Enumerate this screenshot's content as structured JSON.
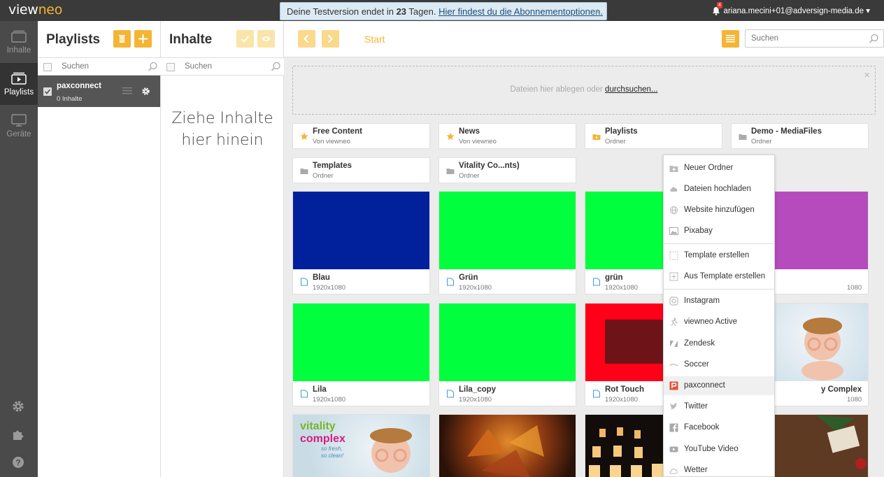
{
  "topbar": {
    "logo_view": "view",
    "logo_neo": "neo",
    "trial_prefix": "Deine Testversion endet in ",
    "trial_days": "23",
    "trial_suffix": " Tagen. ",
    "trial_link": "Hier findest du die Abonnementoptionen.",
    "trial_close": "×",
    "notification_count": "4",
    "user": "ariana.mecini+01@adversign-media.de ▾"
  },
  "leftnav": {
    "items": [
      {
        "label": "Inhalte"
      },
      {
        "label": "Playlists"
      },
      {
        "label": "Geräte"
      }
    ]
  },
  "playlists": {
    "title": "Playlists",
    "search_placeholder": "Suchen",
    "items": [
      {
        "name": "paxconnect",
        "sub": "0 Inhalte"
      }
    ]
  },
  "inhalte": {
    "title": "Inhalte",
    "search_placeholder": "Suchen",
    "drop_hint": "Ziehe Inhalte hier hinein"
  },
  "main": {
    "breadcrumb": "Start",
    "search_placeholder": "Suchen",
    "dropzone_text": "Dateien hier ablegen oder ",
    "dropzone_link": "durchsuchen...",
    "dropzone_close": "×",
    "folders": [
      {
        "name": "Free Content",
        "sub": "Von viewneo",
        "icon": "star-icon"
      },
      {
        "name": "News",
        "sub": "Von viewneo",
        "icon": "star-icon"
      },
      {
        "name": "Playlists",
        "sub": "Ordner",
        "icon": "playlist-folder-icon"
      },
      {
        "name": "Demo - MediaFiles",
        "sub": "Ordner",
        "icon": "folder-icon"
      },
      {
        "name": "Templates",
        "sub": "Ordner",
        "icon": "folder-icon"
      },
      {
        "name": "Vitality Co...nts)",
        "sub": "Ordner",
        "icon": "folder-icon"
      }
    ],
    "tiles": [
      {
        "name": "Blau",
        "sub": "1920x1080",
        "color": "#00209c"
      },
      {
        "name": "Grün",
        "sub": "1920x1080",
        "color": "#00ff3c"
      },
      {
        "name": "grün",
        "sub": "1920x1080",
        "color": "#00ff3c"
      },
      {
        "name": "",
        "sub": "1080",
        "color": "#b54bbd"
      },
      {
        "name": "Lila",
        "sub": "1920x1080",
        "color": "#00ff3c"
      },
      {
        "name": "Lila_copy",
        "sub": "1920x1080",
        "color": "#00ff3c"
      },
      {
        "name": "Rot Touch",
        "sub": "1920x1080",
        "color": "#ff0018"
      },
      {
        "name": "y Complex",
        "sub": "1080",
        "color": "#cfe0ea"
      }
    ],
    "bottom_row_text": {
      "vitality": "vitality",
      "complex": "complex",
      "tagline1": "so fresh,",
      "tagline2": "so clean!"
    }
  },
  "context_menu": {
    "items": [
      {
        "label": "Neuer Ordner",
        "icon": "new-folder-icon"
      },
      {
        "label": "Dateien hochladen",
        "icon": "cloud-upload-icon"
      },
      {
        "label": "Website hinzufügen",
        "icon": "globe-icon"
      },
      {
        "label": "Pixabay",
        "icon": "image-icon"
      },
      {
        "label": "Template erstellen",
        "icon": "template-icon"
      },
      {
        "label": "Aus Template erstellen",
        "icon": "from-template-icon"
      },
      {
        "label": "Instagram",
        "icon": "instagram-icon"
      },
      {
        "label": "viewneo Active",
        "icon": "active-icon"
      },
      {
        "label": "Zendesk",
        "icon": "zendesk-icon"
      },
      {
        "label": "Soccer",
        "icon": "soccer-icon"
      },
      {
        "label": "paxconnect",
        "icon": "paxconnect-icon"
      },
      {
        "label": "Twitter",
        "icon": "twitter-icon"
      },
      {
        "label": "Facebook",
        "icon": "facebook-icon"
      },
      {
        "label": "YouTube Video",
        "icon": "youtube-icon"
      },
      {
        "label": "Wetter",
        "icon": "weather-icon"
      }
    ]
  },
  "colors": {
    "accent": "#f4b534",
    "accent_light": "#fbd98c",
    "nav_bg": "#4a4a4a",
    "topbar_bg": "#3a3a3a",
    "paxconnect_red": "#e0533a"
  }
}
